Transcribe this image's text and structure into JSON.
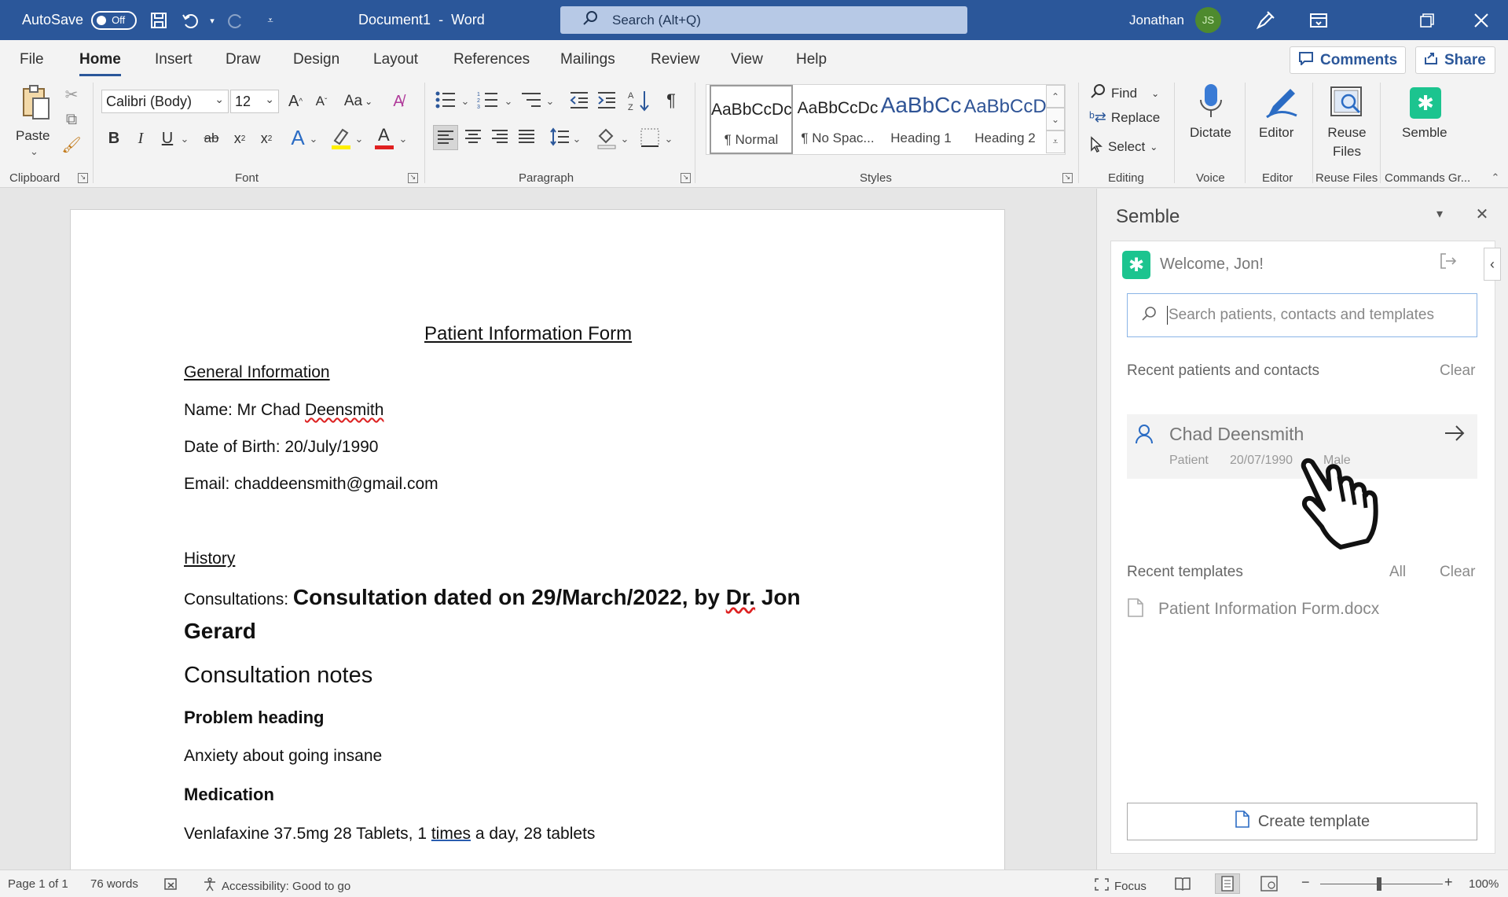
{
  "titlebar": {
    "autosave_label": "AutoSave",
    "autosave_state": "Off",
    "doc_name": "Document1",
    "separator": "-",
    "app_name": "Word",
    "search_placeholder": "Search (Alt+Q)",
    "user_name": "Jonathan",
    "user_initials": "JS",
    "bar_color": "#2b579a"
  },
  "ribbon_tabs": [
    "File",
    "Home",
    "Insert",
    "Draw",
    "Design",
    "Layout",
    "References",
    "Mailings",
    "Review",
    "View",
    "Help"
  ],
  "ribbon_buttons": {
    "comments": "Comments",
    "share": "Share"
  },
  "ribbon": {
    "clipboard": {
      "paste": "Paste",
      "group": "Clipboard"
    },
    "font": {
      "name": "Calibri (Body)",
      "size": "12",
      "case": "Aa",
      "group": "Font"
    },
    "paragraph": {
      "group": "Paragraph"
    },
    "styles": {
      "group": "Styles",
      "items": [
        {
          "sample": "AaBbCcDc",
          "name": "¶ Normal"
        },
        {
          "sample": "AaBbCcDc",
          "name": "¶ No Spac..."
        },
        {
          "sample": "AaBbCc",
          "name": "Heading 1"
        },
        {
          "sample": "AaBbCcD",
          "name": "Heading 2"
        }
      ]
    },
    "editing": {
      "find": "Find",
      "replace": "Replace",
      "select": "Select",
      "group": "Editing"
    },
    "voice": {
      "dictate": "Dictate",
      "group": "Voice"
    },
    "editor": {
      "label": "Editor",
      "group": "Editor"
    },
    "reuse": {
      "label_1": "Reuse",
      "label_2": "Files",
      "group": "Reuse Files"
    },
    "semble": {
      "label": "Semble",
      "group": "Commands Gr..."
    }
  },
  "document": {
    "title": "Patient Information Form",
    "general_heading": "General Information",
    "name_prefix": "Name: Mr Chad ",
    "name_surname": "Deensmith",
    "dob": "Date of Birth: 20/July/1990",
    "email": "Email: chaddeensmith@gmail.com",
    "history_heading": "History",
    "consult_prefix": "Consultations: ",
    "consult_title_a": "Consultation dated on 29/March/2022, by ",
    "consult_title_dr": "Dr.",
    "consult_title_b": " Jon",
    "consult_title_c": "Gerard",
    "notes_heading": "Consultation notes",
    "problem_heading": "Problem heading",
    "problem_text": "Anxiety about going insane",
    "medication_heading": "Medication",
    "med_text_a": "Venlafaxine 37.5mg 28 Tablets, 1 ",
    "med_text_times": "times",
    "med_text_b": " a day, 28 tablets"
  },
  "pane": {
    "title": "Semble",
    "welcome": "Welcome, Jon!",
    "search_placeholder": "Search patients, contacts and templates",
    "recent_contacts_label": "Recent patients and contacts",
    "clear": "Clear",
    "patient": {
      "name": "Chad Deensmith",
      "type": "Patient",
      "dob": "20/07/1990",
      "sex": "Male"
    },
    "recent_templates_label": "Recent templates",
    "all": "All",
    "template_file": "Patient Information Form.docx",
    "create_template": "Create template",
    "brand_color": "#1cc48f"
  },
  "statusbar": {
    "page": "Page 1 of 1",
    "words": "76 words",
    "accessibility": "Accessibility: Good to go",
    "focus": "Focus",
    "zoom": "100%"
  }
}
